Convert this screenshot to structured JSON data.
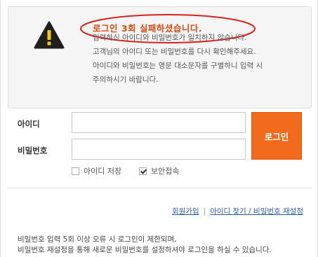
{
  "alert": {
    "title": "로그인 3회 실패하셨습니다.",
    "lines": [
      "입력하신 아이디와 비밀번호가 일치하지 않습니다.",
      "고객님의 아이디 또는 비밀번호를 다시 확인해주세요.",
      "아이디와 비밀번호는 영문 대소문자를 구별하니 입력 시",
      "주의하시기 바랍니다."
    ],
    "icon": "warning-icon",
    "highlight_color": "#d9231d"
  },
  "form": {
    "id_label": "아이디",
    "password_label": "비밀번호",
    "id_value": "",
    "password_value": "",
    "login_button": "로그인",
    "save_id_label": "아이디 저장",
    "save_id_checked": false,
    "secure_login_label": "보안접속",
    "secure_login_checked": true,
    "accent_color": "#f26a1b"
  },
  "links": {
    "signup": "회원가입",
    "separator": "|",
    "find_account": "아이디 찾기 / 비밀번호 재설정"
  },
  "notice": {
    "lines": [
      "비밀번호 입력 5회 이상 오류 시 로그인이 제한되며,",
      "비밀번호 재설정을 통해 새로운 비밀번호를 설정하셔야 로그인을 하실 수 있습니다."
    ]
  }
}
